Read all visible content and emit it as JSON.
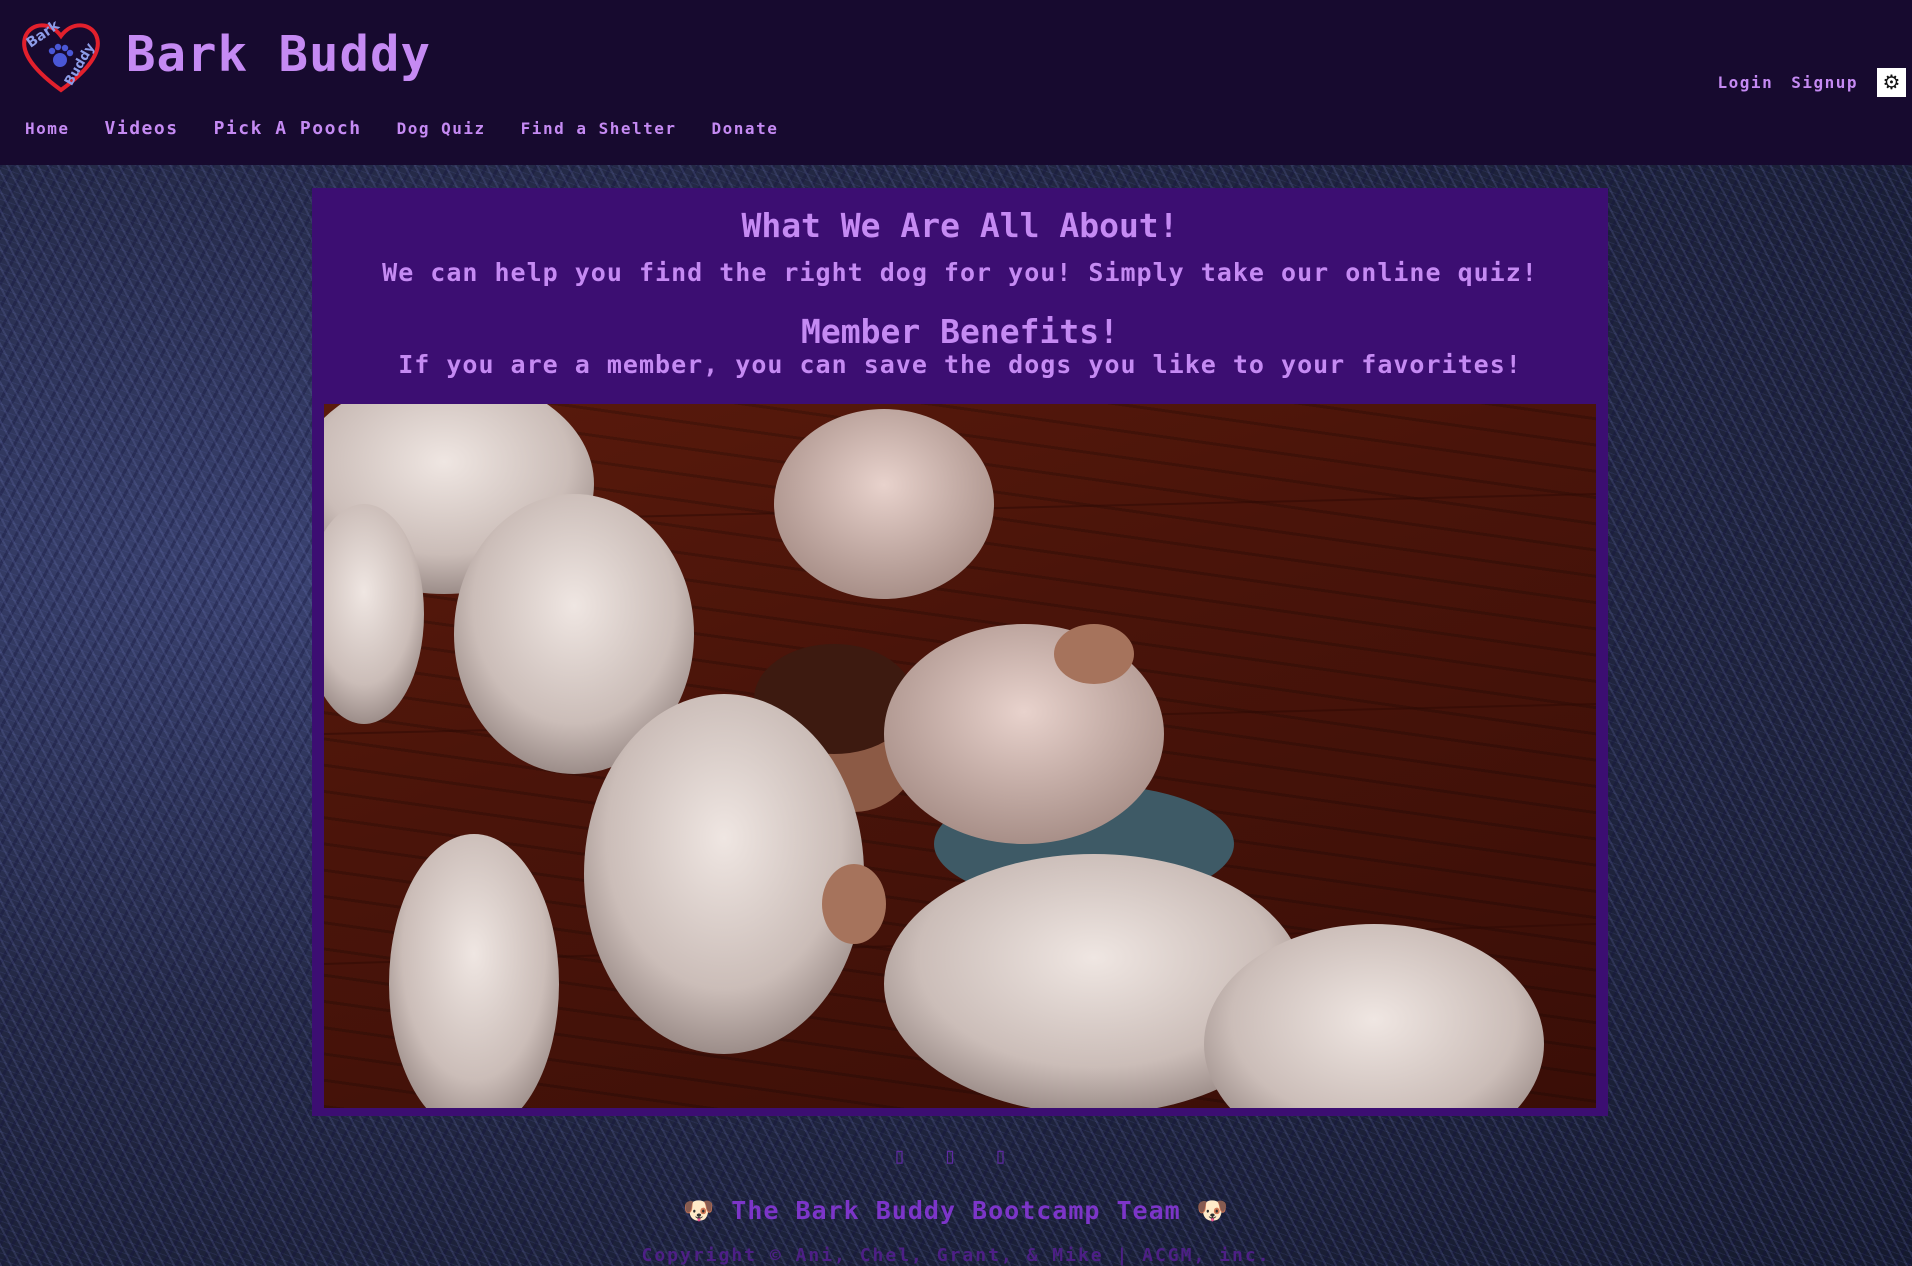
{
  "brand": {
    "name": "Bark Buddy",
    "logo_text_top": "Bark",
    "logo_text_bottom": "Buddy"
  },
  "nav": {
    "items": [
      "Home",
      "Videos",
      "Pick A Pooch",
      "Dog Quiz",
      "Find a Shelter",
      "Donate"
    ]
  },
  "auth": {
    "login": "Login",
    "signup": "Signup"
  },
  "theme_toggle": {
    "icon": "gear-icon",
    "glyph": "⚙"
  },
  "main": {
    "title": "What We Are All About!",
    "text": "We can help you find the right dog for you! Simply take our online quiz!",
    "benefits_title": "Member Benefits!",
    "benefits_text": "If you are a member, you can save the dogs you like to your favorites!"
  },
  "footer": {
    "icons": "▯ ▯ ▯",
    "team": "🐶 The Bark Buddy Bootcamp Team 🐶",
    "copyright": "Copyright © Ani, Chel, Grant, & Mike | ACGM, inc."
  },
  "colors": {
    "header_bg": "#170a2f",
    "accent": "#c58af3",
    "card_bg": "#3c0e72",
    "footer_text": "#7c35c9"
  }
}
